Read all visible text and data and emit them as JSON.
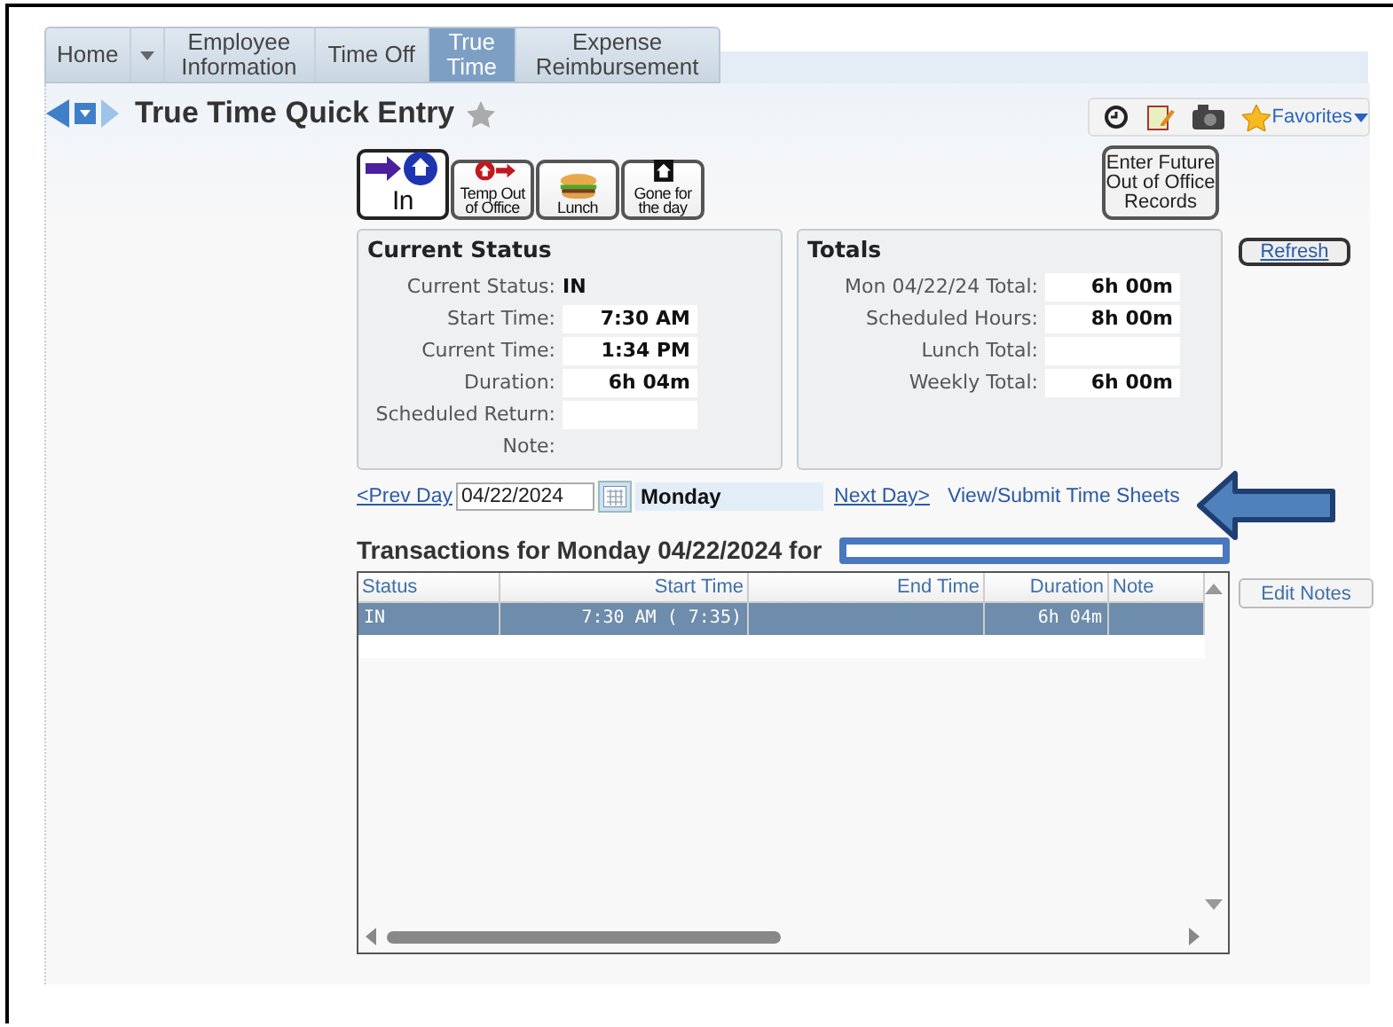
{
  "nav": {
    "tabs": [
      {
        "label": "Home",
        "selected": false,
        "dropdown": true
      },
      {
        "label": "Employee Information",
        "selected": false,
        "dropdown": false
      },
      {
        "label": "Time Off",
        "selected": false,
        "dropdown": false
      },
      {
        "label": "True Time",
        "selected": true,
        "dropdown": false
      },
      {
        "label": "Expense Reimbursement",
        "selected": false,
        "dropdown": false
      }
    ]
  },
  "page": {
    "title": "True Time Quick Entry",
    "favorites": "Favorites"
  },
  "actions": [
    {
      "kind": "in",
      "label": "In",
      "selected": true
    },
    {
      "kind": "out",
      "label": "Temp Out of Office",
      "selected": false
    },
    {
      "kind": "lunch",
      "label": "Lunch",
      "selected": false
    },
    {
      "kind": "gone",
      "label": "Gone for the day",
      "selected": false
    }
  ],
  "future_button": "Enter Future Out of Office Records",
  "refresh_button": "Refresh",
  "current_status": {
    "title": "Current Status",
    "fields": [
      {
        "label": "Current Status:",
        "value": "IN",
        "kind": "plain"
      },
      {
        "label": "Start Time:",
        "value": "7:30 AM",
        "kind": "box"
      },
      {
        "label": "Current Time:",
        "value": "1:34 PM",
        "kind": "box"
      },
      {
        "label": "Duration:",
        "value": "6h 04m",
        "kind": "box"
      },
      {
        "label": "Scheduled Return:",
        "kind": "box"
      },
      {
        "label": "Note:",
        "kind": "plain"
      }
    ]
  },
  "totals": {
    "title": "Totals",
    "fields": [
      {
        "label": "Mon 04/22/24 Total:",
        "value": "6h 00m",
        "kind": "box"
      },
      {
        "label": "Scheduled Hours:",
        "value": "8h 00m",
        "kind": "box"
      },
      {
        "label": "Lunch Total:",
        "kind": "box"
      },
      {
        "label": "Weekly Total:",
        "value": "6h 00m",
        "kind": "box"
      }
    ]
  },
  "date_nav": {
    "prev": "<Prev Day",
    "date": "04/22/2024",
    "day": "Monday",
    "next": "Next Day>",
    "view": "View/Submit Time Sheets"
  },
  "transactions": {
    "title": "Transactions for Monday 04/22/2024 for",
    "columns": [
      "Status",
      "Start Time",
      "End Time",
      "Duration",
      "Note"
    ],
    "rows": [
      {
        "cells": [
          "IN",
          "7:30 AM ( 7:35)",
          "",
          "6h 04m",
          ""
        ],
        "selected": true
      }
    ]
  },
  "edit_notes_button": "Edit Notes"
}
